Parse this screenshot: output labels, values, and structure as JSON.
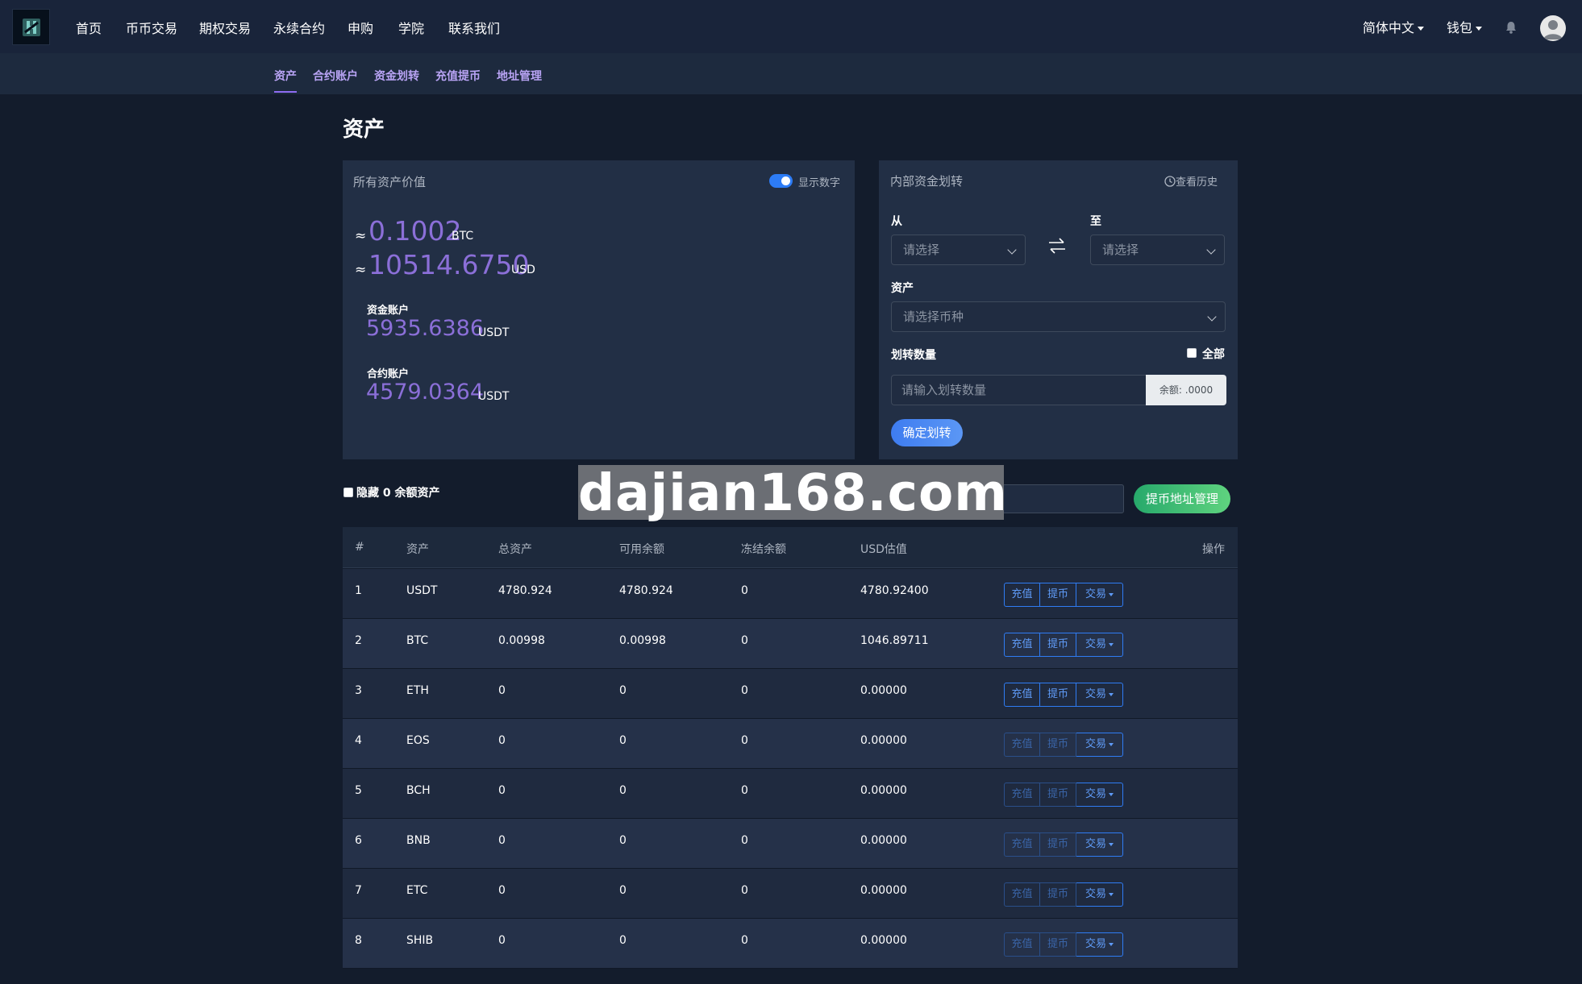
{
  "nav": {
    "items": [
      "首页",
      "币币交易",
      "期权交易",
      "永续合约",
      "申购",
      "学院",
      "联系我们"
    ],
    "language": "简体中文",
    "wallet": "钱包"
  },
  "subnav": {
    "items": [
      "资产",
      "合约账户",
      "资金划转",
      "充值提币",
      "地址管理"
    ],
    "active": "资产"
  },
  "page_title": "资产",
  "assets_panel": {
    "title": "所有资产价值",
    "toggle_label": "显示数字",
    "toggle_on": true,
    "approx_symbol": "≈",
    "btc_value": "0.1002",
    "btc_unit": "BTC",
    "usd_value": "10514.6750",
    "usd_unit": "USD",
    "funding_label": "资金账户",
    "funding_value": "5935.6386",
    "funding_unit": "USDT",
    "contract_label": "合约账户",
    "contract_value": "4579.0364",
    "contract_unit": "USDT"
  },
  "transfer_panel": {
    "title": "内部资金划转",
    "history_label": "查看历史",
    "from_label": "从",
    "to_label": "至",
    "from_placeholder": "请选择",
    "to_placeholder": "请选择",
    "asset_label": "资产",
    "asset_placeholder": "请选择币种",
    "amount_label": "划转数量",
    "all_label": "全部",
    "amount_placeholder": "请输入划转数量",
    "balance": "余额: .0000",
    "confirm_button": "确定划转"
  },
  "filters": {
    "hide_zero_label": "隐藏 0 余额资产",
    "address_button": "提币地址管理"
  },
  "watermark": "dajian168.com",
  "table": {
    "headers": [
      "#",
      "资产",
      "总资产",
      "可用余额",
      "冻结余额",
      "USD估值",
      "操作"
    ],
    "actions": {
      "deposit": "充值",
      "withdraw": "提币",
      "trade": "交易"
    },
    "rows": [
      {
        "idx": "1",
        "asset": "USDT",
        "total": "4780.924",
        "available": "4780.924",
        "frozen": "0",
        "usd": "4780.92400",
        "enabled": true
      },
      {
        "idx": "2",
        "asset": "BTC",
        "total": "0.00998",
        "available": "0.00998",
        "frozen": "0",
        "usd": "1046.89711",
        "enabled": true
      },
      {
        "idx": "3",
        "asset": "ETH",
        "total": "0",
        "available": "0",
        "frozen": "0",
        "usd": "0.00000",
        "enabled": true
      },
      {
        "idx": "4",
        "asset": "EOS",
        "total": "0",
        "available": "0",
        "frozen": "0",
        "usd": "0.00000",
        "enabled": false
      },
      {
        "idx": "5",
        "asset": "BCH",
        "total": "0",
        "available": "0",
        "frozen": "0",
        "usd": "0.00000",
        "enabled": false
      },
      {
        "idx": "6",
        "asset": "BNB",
        "total": "0",
        "available": "0",
        "frozen": "0",
        "usd": "0.00000",
        "enabled": false
      },
      {
        "idx": "7",
        "asset": "ETC",
        "total": "0",
        "available": "0",
        "frozen": "0",
        "usd": "0.00000",
        "enabled": false
      },
      {
        "idx": "8",
        "asset": "SHIB",
        "total": "0",
        "available": "0",
        "frozen": "0",
        "usd": "0.00000",
        "enabled": false
      }
    ]
  },
  "colors": {
    "background": "#131c2c",
    "accent_purple": "#8b6fd8",
    "primary_blue": "#2f7cf4",
    "success_green": "#27a96b"
  }
}
